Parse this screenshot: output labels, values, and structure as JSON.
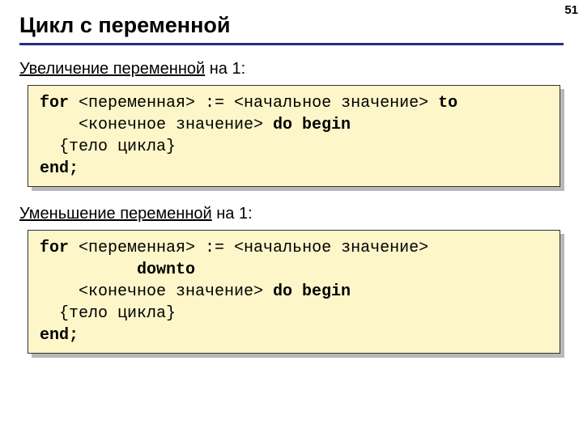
{
  "page_number": "51",
  "title": "Цикл с переменной",
  "section1": {
    "label_underlined": "Увеличение переменной",
    "label_rest": " на 1:",
    "code": {
      "l1a": "for",
      "l1b": " <переменная> := <начальное значение> ",
      "l1c": "to",
      "l2a": "    <конечное значение> ",
      "l2b": "do begin",
      "l3": "  {тело цикла}",
      "l4": "end;"
    }
  },
  "section2": {
    "label_underlined": "Уменьшение переменной",
    "label_rest": " на 1:",
    "code": {
      "l1a": "for",
      "l1b": " <переменная> := <начальное значение>",
      "l2a": "          ",
      "l2b": "downto",
      "l3a": "    <конечное значение> ",
      "l3b": "do begin",
      "l4": "  {тело цикла}",
      "l5": "end;"
    }
  }
}
